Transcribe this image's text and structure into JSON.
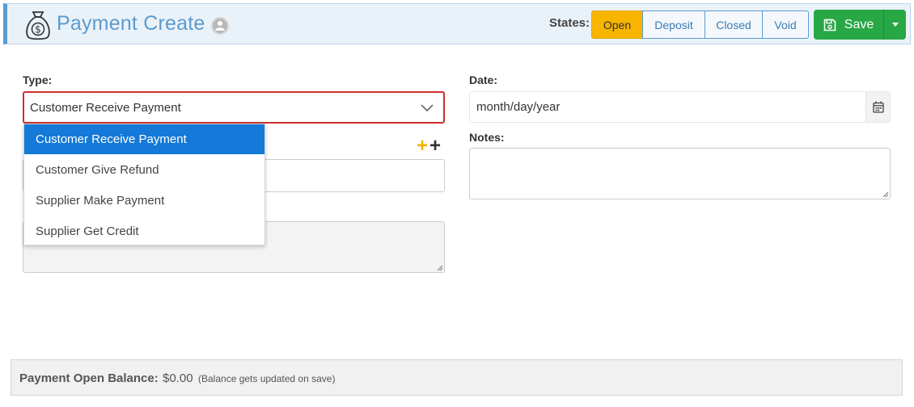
{
  "header": {
    "title": "Payment Create",
    "icon": "money-bag-icon",
    "help_icon": "user-circle-icon",
    "states_label": "States:",
    "states": [
      {
        "label": "Open",
        "active": true
      },
      {
        "label": "Deposit",
        "active": false
      },
      {
        "label": "Closed",
        "active": false
      },
      {
        "label": "Void",
        "active": false
      }
    ],
    "save_label": "Save"
  },
  "form": {
    "type_label": "Type:",
    "type_value": "Customer Receive Payment",
    "date_label": "Date:",
    "date_placeholder": "month/day/year",
    "notes_label": "Notes:",
    "notes_value": ""
  },
  "dropdown": {
    "options": [
      {
        "label": "Customer Receive Payment",
        "selected": true
      },
      {
        "label": "Customer Give Refund",
        "selected": false
      },
      {
        "label": "Supplier Make Payment",
        "selected": false
      },
      {
        "label": "Supplier Get Credit",
        "selected": false
      }
    ]
  },
  "balance": {
    "label": "Payment Open Balance:",
    "amount": "$0.00",
    "note": "(Balance gets updated on save)"
  },
  "colors": {
    "accent": "#5a9bd0",
    "open_state": "#f7b500",
    "save": "#28a745",
    "error_border": "#c9302c",
    "selected_option": "#1479d8"
  }
}
